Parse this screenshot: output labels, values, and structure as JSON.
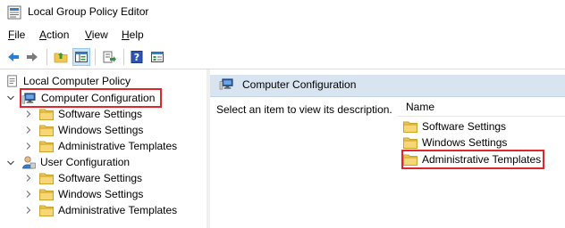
{
  "window": {
    "title": "Local Group Policy Editor",
    "icon": "gpedit-icon"
  },
  "menu": [
    {
      "label": "File",
      "u": "F",
      "rest": "ile"
    },
    {
      "label": "Action",
      "u": "A",
      "rest": "ction"
    },
    {
      "label": "View",
      "u": "V",
      "rest": "iew"
    },
    {
      "label": "Help",
      "u": "H",
      "rest": "elp"
    }
  ],
  "toolbar": {
    "buttons": [
      "back-icon",
      "forward-icon",
      "up-folder-icon",
      "show-hide-tree-icon",
      "export-list-icon",
      "help-icon",
      "properties-icon"
    ]
  },
  "tree": {
    "root": "Local Computer Policy",
    "computer": {
      "label": "Computer Configuration",
      "children": [
        "Software Settings",
        "Windows Settings",
        "Administrative Templates"
      ]
    },
    "user": {
      "label": "User Configuration",
      "children": [
        "Software Settings",
        "Windows Settings",
        "Administrative Templates"
      ]
    }
  },
  "details": {
    "header": "Computer Configuration",
    "description": "Select an item to view its description.",
    "column": "Name",
    "items": [
      "Software Settings",
      "Windows Settings",
      "Administrative Templates"
    ]
  },
  "colors": {
    "highlight": "#e0262b",
    "folder": "#f0c850",
    "header_bg": "#d9e4f1"
  }
}
